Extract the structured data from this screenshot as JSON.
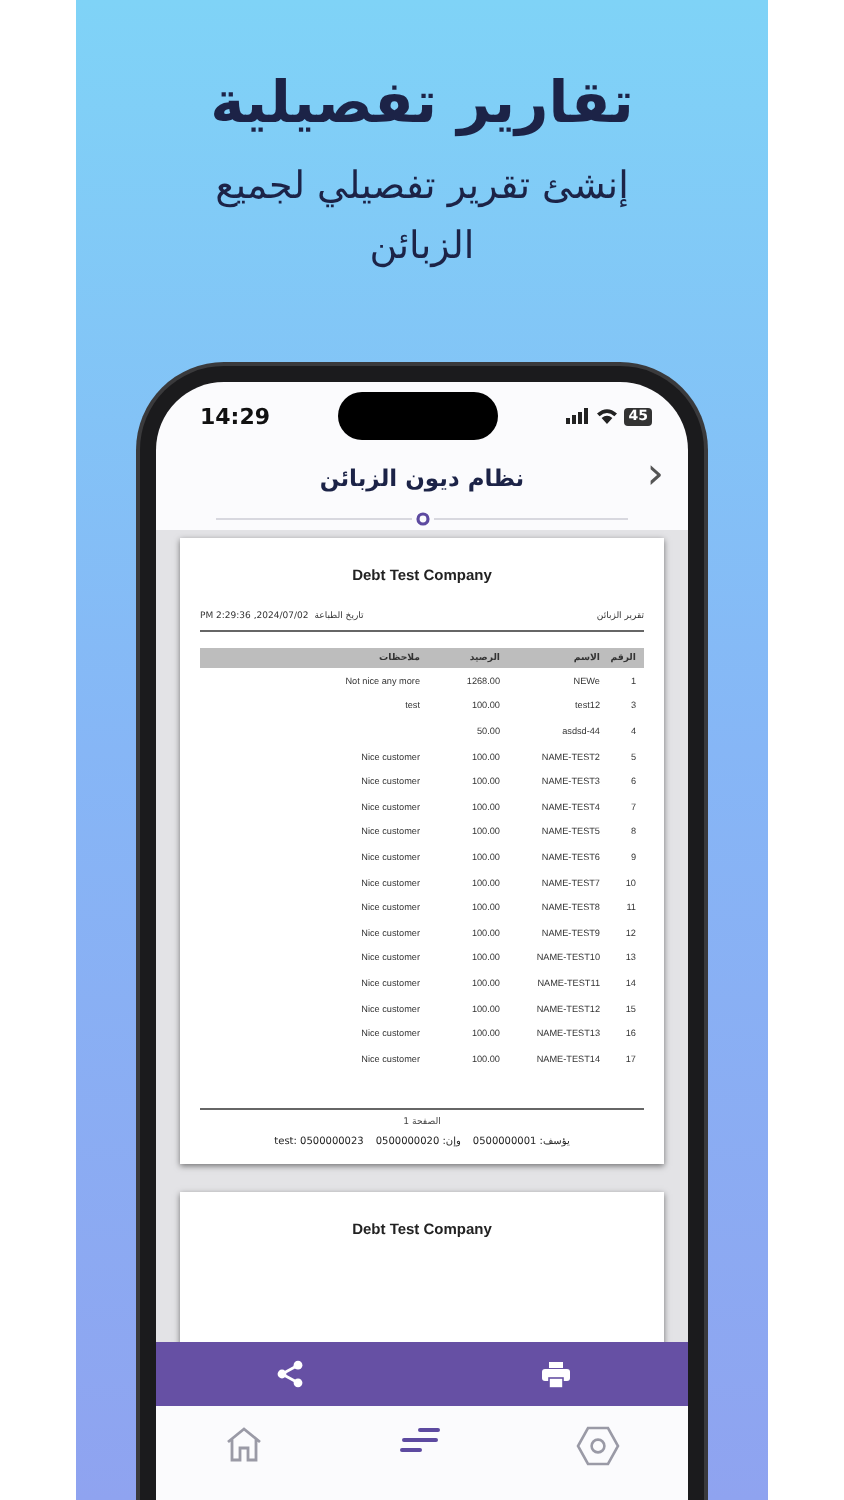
{
  "headline": "تقارير تفصيلية",
  "subtitle": "إنشئ تقرير تفصيلي لجميع الزبائن",
  "status_bar": {
    "time": "14:29",
    "battery": "45"
  },
  "header": {
    "title": "نظام ديون الزبائن",
    "back": "›"
  },
  "report": {
    "company": "Debt Test Company",
    "report_title": "تقرير الزبائن",
    "print_date_label": "تاريخ الطباعة",
    "print_date": "2024/07/02, 2:29:36 PM",
    "columns": [
      "ملاحظات",
      "الرصيد",
      "الاسم",
      "الرقم"
    ],
    "rows": [
      [
        "Not nice any more",
        "1268.00",
        "NEWe",
        "1"
      ],
      [
        "test",
        "100.00",
        "test12",
        "3"
      ],
      [
        "",
        "50.00",
        "asdsd-44",
        "4"
      ],
      [
        "Nice customer",
        "100.00",
        "NAME-TEST2",
        "5"
      ],
      [
        "Nice customer",
        "100.00",
        "NAME-TEST3",
        "6"
      ],
      [
        "Nice customer",
        "100.00",
        "NAME-TEST4",
        "7"
      ],
      [
        "Nice customer",
        "100.00",
        "NAME-TEST5",
        "8"
      ],
      [
        "Nice customer",
        "100.00",
        "NAME-TEST6",
        "9"
      ],
      [
        "Nice customer",
        "100.00",
        "NAME-TEST7",
        "10"
      ],
      [
        "Nice customer",
        "100.00",
        "NAME-TEST8",
        "11"
      ],
      [
        "Nice customer",
        "100.00",
        "NAME-TEST9",
        "12"
      ],
      [
        "Nice customer",
        "100.00",
        "NAME-TEST10",
        "13"
      ],
      [
        "Nice customer",
        "100.00",
        "NAME-TEST11",
        "14"
      ],
      [
        "Nice customer",
        "100.00",
        "NAME-TEST12",
        "15"
      ],
      [
        "Nice customer",
        "100.00",
        "NAME-TEST13",
        "16"
      ],
      [
        "Nice customer",
        "100.00",
        "NAME-TEST14",
        "17"
      ]
    ],
    "page_label": "الصفحة 1",
    "footer": [
      "يؤسف: 0500000001",
      "وإن: 0500000020",
      "test: 0500000023"
    ]
  },
  "next_page": {
    "company": "Debt Test Company"
  },
  "nav": [
    {
      "kind": "home",
      "selected": false
    },
    {
      "kind": "reports",
      "selected": true
    },
    {
      "kind": "settings",
      "selected": false
    }
  ]
}
